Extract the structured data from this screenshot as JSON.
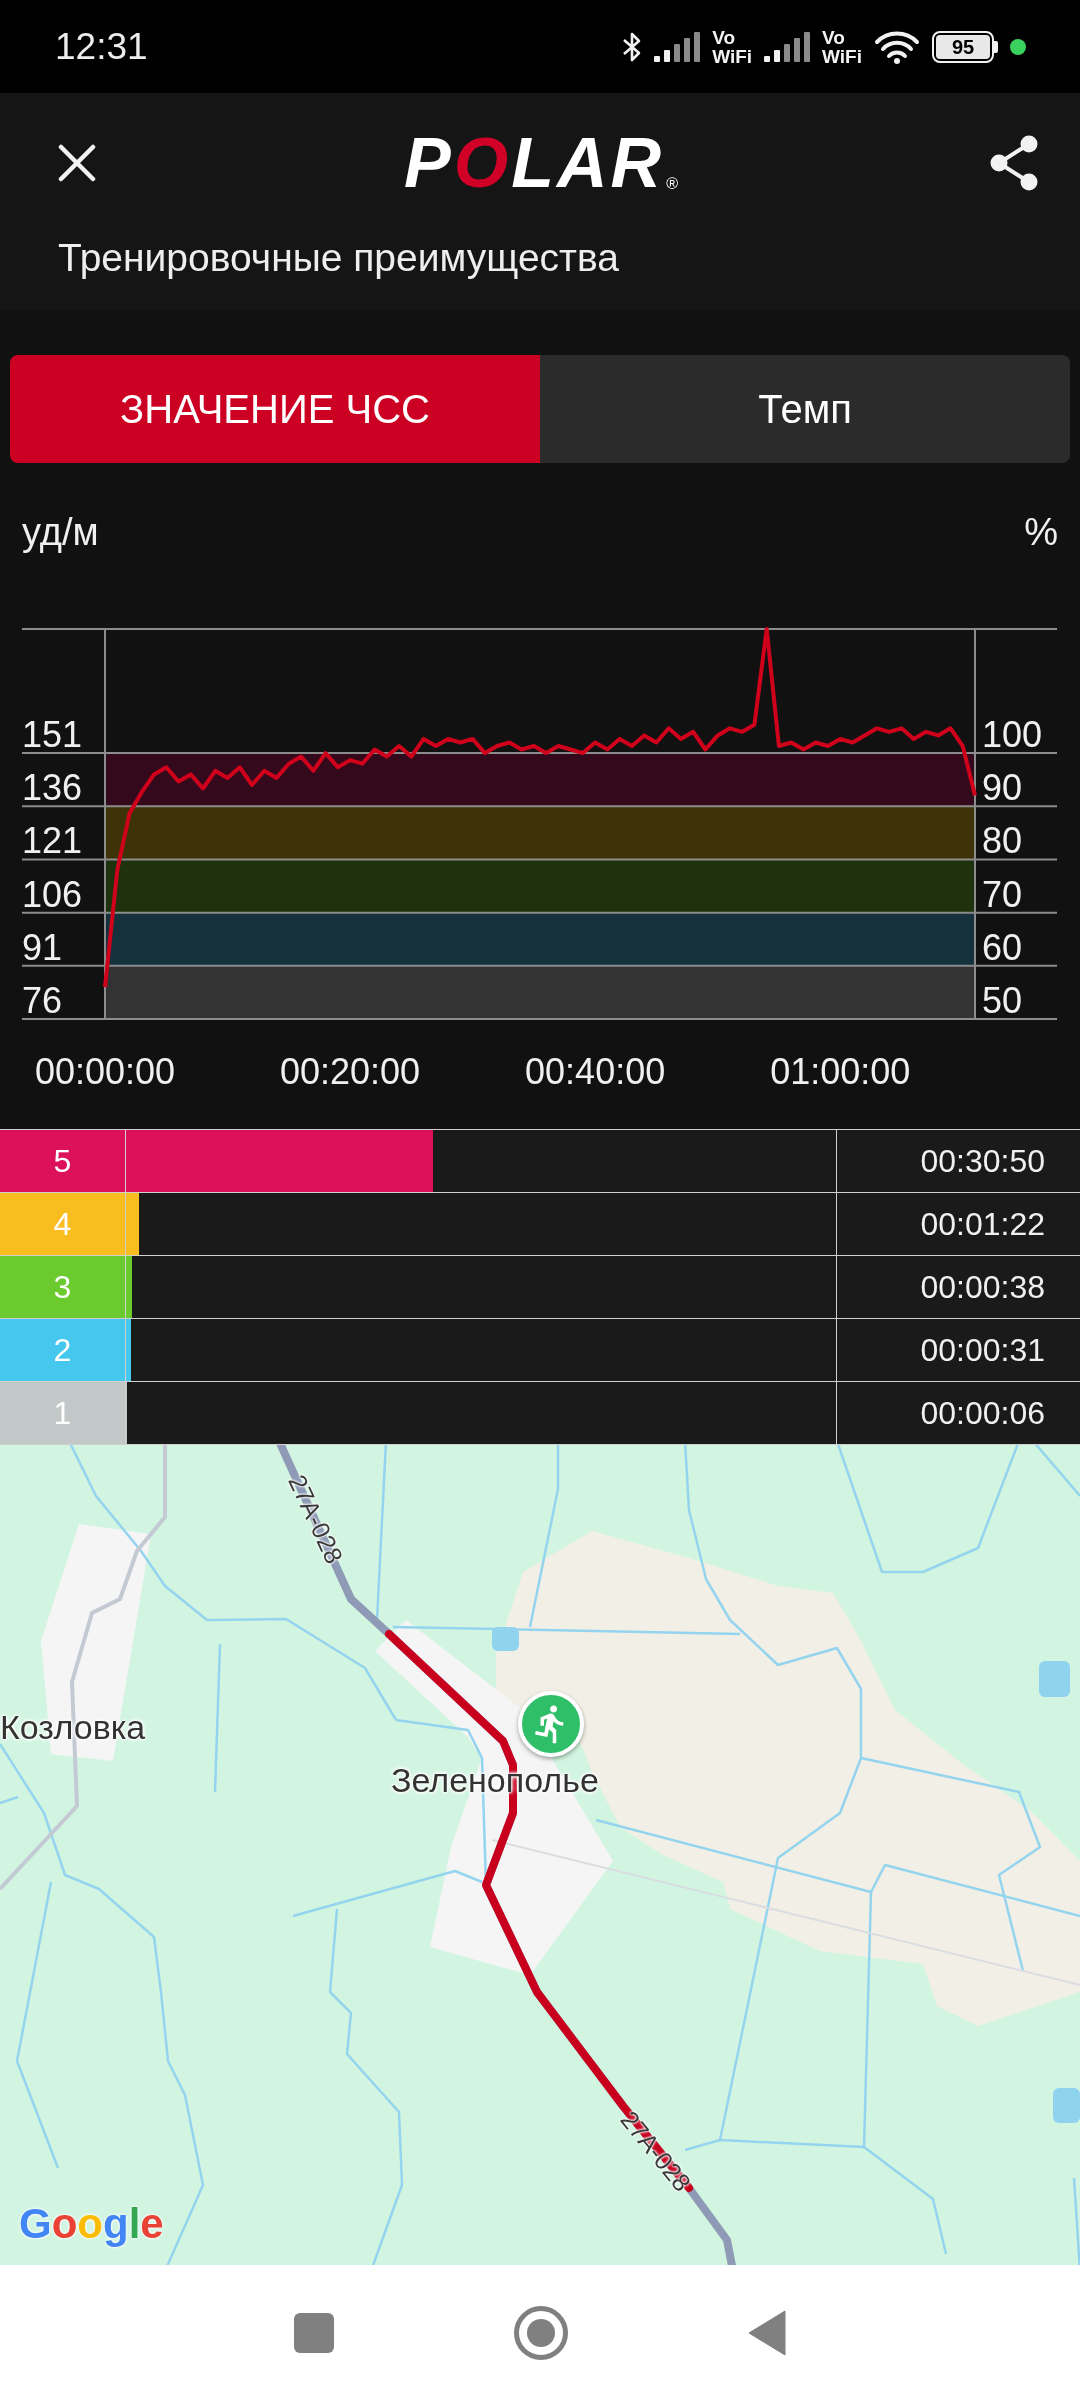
{
  "status_bar": {
    "time": "12:31",
    "volte": [
      {
        "line1": "Vo",
        "line2": "WiFi"
      },
      {
        "line1": "Vo",
        "line2": "WiFi"
      }
    ],
    "battery": "95"
  },
  "header": {
    "logo": "POLAR",
    "logo_mark": "®",
    "subtitle": "Тренировочные преимущества"
  },
  "hr_chart": {
    "tabs": [
      {
        "label": "ЗНАЧЕНИЕ ЧСС",
        "selected": true
      },
      {
        "label": "Темп",
        "selected": false
      }
    ],
    "right_unit": "%",
    "right_ticks": [
      "100",
      "90",
      "80",
      "70",
      "60",
      "50"
    ],
    "chart_data": {
      "type": "line",
      "ylabel": "уд/м",
      "grid": true,
      "x": [
        0,
        1,
        2,
        3,
        4,
        5,
        6,
        7,
        8,
        9,
        10,
        11,
        12,
        13,
        14,
        15,
        16,
        17,
        18,
        19,
        20,
        21,
        22,
        23,
        24,
        25,
        26,
        27,
        28,
        29,
        30,
        31,
        32,
        33,
        34,
        35,
        36,
        37,
        38,
        39,
        40,
        41,
        42,
        43,
        44,
        45,
        46,
        47,
        48,
        49,
        50,
        51,
        52,
        53,
        54,
        55,
        56,
        57,
        58,
        59,
        60,
        61,
        62,
        63,
        64,
        65,
        66,
        67,
        68,
        69,
        70,
        71
      ],
      "series": [
        {
          "color": "#d0021b",
          "values": [
            85,
            118,
            134,
            140,
            145,
            147,
            143,
            145,
            141,
            146,
            144,
            147,
            142,
            146,
            144,
            148,
            150,
            146,
            151,
            147,
            149,
            148,
            152,
            150,
            153,
            150,
            155,
            153,
            155,
            154,
            155,
            151,
            153,
            154,
            152,
            153,
            151,
            153,
            152,
            151,
            154,
            152,
            155,
            153,
            156,
            154,
            158,
            155,
            157,
            152,
            156,
            158,
            157,
            159,
            186,
            153,
            154,
            152,
            154,
            153,
            155,
            154,
            156,
            158,
            157,
            158,
            155,
            157,
            156,
            158,
            153,
            139
          ]
        }
      ],
      "bands": [
        {
          "axis": "y",
          "from": 136,
          "to": 151,
          "color": "#34091b"
        },
        {
          "axis": "y",
          "from": 121,
          "to": 136,
          "color": "#3e3209"
        },
        {
          "axis": "y",
          "from": 106,
          "to": 121,
          "color": "#1e320d"
        },
        {
          "axis": "y",
          "from": 91,
          "to": 106,
          "color": "#15323c"
        },
        {
          "axis": "y",
          "from": 76,
          "to": 91,
          "color": "#333333"
        }
      ],
      "xlim": [
        0,
        71
      ],
      "ylim": [
        76,
        186
      ],
      "xticks": [
        {
          "value": 0,
          "label": "00:00:00"
        },
        {
          "value": 20,
          "label": "00:20:00"
        },
        {
          "value": 40,
          "label": "00:40:00"
        },
        {
          "value": 60,
          "label": "01:00:00"
        }
      ],
      "yticks": [
        76,
        91,
        106,
        121,
        136,
        151
      ]
    }
  },
  "zones": [
    {
      "number": "5",
      "color": "#dd1159",
      "level": 0.432,
      "time": "00:30:50"
    },
    {
      "number": "4",
      "color": "#f9bd1f",
      "level": 0.019,
      "time": "00:01:22"
    },
    {
      "number": "3",
      "color": "#6bcb2e",
      "level": 0.009,
      "time": "00:00:38"
    },
    {
      "number": "2",
      "color": "#46c7ee",
      "level": 0.007,
      "time": "00:00:31"
    },
    {
      "number": "1",
      "color": "#c2c7c7",
      "level": 0.002,
      "time": "00:00:06"
    }
  ],
  "map": {
    "places": [
      "Козловка",
      "Зеленополье"
    ],
    "road_labels": [
      "27A-028",
      "27A-028"
    ],
    "attribution": "Google"
  }
}
